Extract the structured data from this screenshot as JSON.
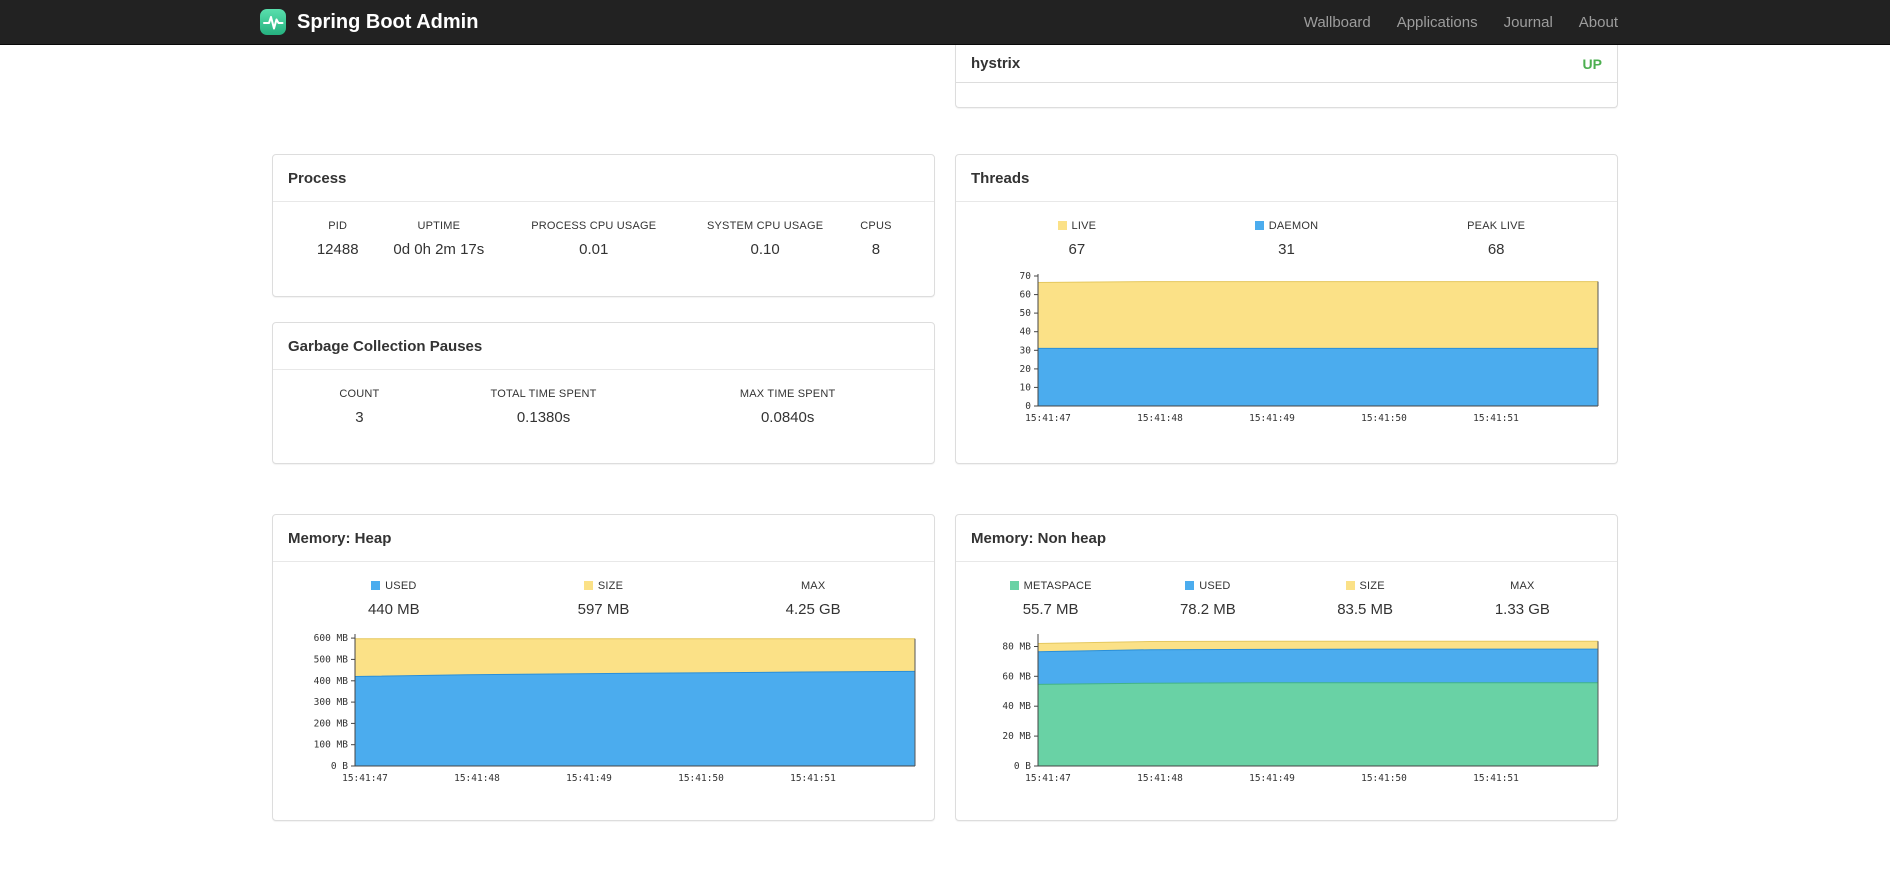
{
  "navbar": {
    "brand": "Spring Boot Admin",
    "links": [
      {
        "label": "Wallboard"
      },
      {
        "label": "Applications"
      },
      {
        "label": "Journal"
      },
      {
        "label": "About"
      }
    ]
  },
  "application_card": {
    "name": "hystrix",
    "status": "UP",
    "status_color": "#4CAF50"
  },
  "process_card": {
    "title": "Process",
    "metrics": [
      {
        "label": "PID",
        "value": "12488"
      },
      {
        "label": "UPTIME",
        "value": "0d 0h 2m 17s"
      },
      {
        "label": "PROCESS CPU USAGE",
        "value": "0.01"
      },
      {
        "label": "SYSTEM CPU USAGE",
        "value": "0.10"
      },
      {
        "label": "CPUS",
        "value": "8"
      }
    ]
  },
  "gc_card": {
    "title": "Garbage Collection Pauses",
    "metrics": [
      {
        "label": "COUNT",
        "value": "3"
      },
      {
        "label": "TOTAL TIME SPENT",
        "value": "0.1380s"
      },
      {
        "label": "MAX TIME SPENT",
        "value": "0.0840s"
      }
    ]
  },
  "threads_card": {
    "title": "Threads",
    "metrics": [
      {
        "label": "LIVE",
        "value": "67",
        "color": "#FBE187"
      },
      {
        "label": "DAEMON",
        "value": "31",
        "color": "#4BACEE"
      },
      {
        "label": "PEAK LIVE",
        "value": "68"
      }
    ]
  },
  "heap_card": {
    "title": "Memory: Heap",
    "metrics": [
      {
        "label": "USED",
        "value": "440 MB",
        "color": "#4BACEE"
      },
      {
        "label": "SIZE",
        "value": "597 MB",
        "color": "#FBE187"
      },
      {
        "label": "MAX",
        "value": "4.25 GB"
      }
    ]
  },
  "nonheap_card": {
    "title": "Memory: Non heap",
    "metrics": [
      {
        "label": "METASPACE",
        "value": "55.7 MB",
        "color": "#69D2A5"
      },
      {
        "label": "USED",
        "value": "78.2 MB",
        "color": "#4BACEE"
      },
      {
        "label": "SIZE",
        "value": "83.5 MB",
        "color": "#FBE187"
      },
      {
        "label": "MAX",
        "value": "1.33 GB"
      }
    ]
  },
  "chart_data": [
    {
      "id": "threads",
      "type": "area",
      "title": "Threads",
      "x_labels": [
        "15:41:47",
        "15:41:48",
        "15:41:49",
        "15:41:50",
        "15:41:51"
      ],
      "ylim": [
        0,
        70
      ],
      "grid": false,
      "legend_position": "top",
      "yticks": [
        {
          "v": 0,
          "label": "0"
        },
        {
          "v": 10,
          "label": "10"
        },
        {
          "v": 20,
          "label": "20"
        },
        {
          "v": 30,
          "label": "30"
        },
        {
          "v": 40,
          "label": "40"
        },
        {
          "v": 50,
          "label": "50"
        },
        {
          "v": 60,
          "label": "60"
        },
        {
          "v": 70,
          "label": "70"
        }
      ],
      "series": [
        {
          "name": "LIVE",
          "color": "#FBE187",
          "stroke": "#E5C85F",
          "values": [
            66.5,
            67,
            67,
            67,
            67,
            67
          ]
        },
        {
          "name": "DAEMON",
          "color": "#4BACEE",
          "stroke": "#2A8FD8",
          "values": [
            31,
            31,
            31,
            31,
            31,
            31
          ]
        }
      ]
    },
    {
      "id": "memory-heap",
      "type": "area",
      "title": "Memory: Heap",
      "x_labels": [
        "15:41:47",
        "15:41:48",
        "15:41:49",
        "15:41:50",
        "15:41:51"
      ],
      "ylim": [
        0,
        610
      ],
      "grid": false,
      "legend_position": "top",
      "yticks": [
        {
          "v": 0,
          "label": "0 B"
        },
        {
          "v": 100,
          "label": "100 MB"
        },
        {
          "v": 200,
          "label": "200 MB"
        },
        {
          "v": 300,
          "label": "300 MB"
        },
        {
          "v": 400,
          "label": "400 MB"
        },
        {
          "v": 500,
          "label": "500 MB"
        },
        {
          "v": 600,
          "label": "600 MB"
        }
      ],
      "series": [
        {
          "name": "SIZE",
          "color": "#FBE187",
          "stroke": "#E5C85F",
          "values": [
            597,
            597,
            597,
            597,
            597,
            597
          ]
        },
        {
          "name": "USED",
          "color": "#4BACEE",
          "stroke": "#2A8FD8",
          "values": [
            420,
            428,
            433,
            437,
            441,
            444
          ]
        }
      ]
    },
    {
      "id": "memory-nonheap",
      "type": "area",
      "title": "Memory: Non heap",
      "x_labels": [
        "15:41:47",
        "15:41:48",
        "15:41:49",
        "15:41:50",
        "15:41:51"
      ],
      "ylim": [
        0,
        87
      ],
      "grid": false,
      "legend_position": "top",
      "yticks": [
        {
          "v": 0,
          "label": "0 B"
        },
        {
          "v": 20,
          "label": "20 MB"
        },
        {
          "v": 40,
          "label": "40 MB"
        },
        {
          "v": 60,
          "label": "60 MB"
        },
        {
          "v": 80,
          "label": "80 MB"
        }
      ],
      "series": [
        {
          "name": "SIZE",
          "color": "#FBE187",
          "stroke": "#E5C85F",
          "values": [
            82,
            83.3,
            83.5,
            83.5,
            83.5,
            83.5
          ]
        },
        {
          "name": "USED",
          "color": "#4BACEE",
          "stroke": "#2A8FD8",
          "values": [
            76.5,
            77.8,
            78,
            78.2,
            78.2,
            78.2
          ]
        },
        {
          "name": "METASPACE",
          "color": "#69D2A5",
          "stroke": "#43B386",
          "values": [
            54.6,
            55.4,
            55.7,
            55.7,
            55.7,
            55.7
          ]
        }
      ]
    }
  ]
}
